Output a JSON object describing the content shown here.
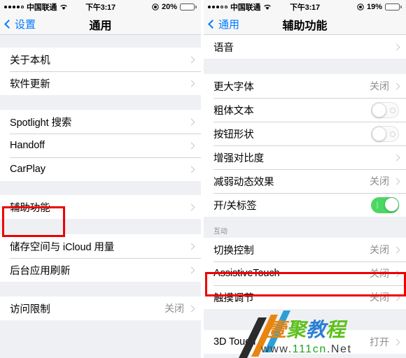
{
  "left_screen": {
    "status_bar": {
      "carrier": "中国联通",
      "signal_dots": 5,
      "signal_filled": 4,
      "wifi_icon": "wifi-icon",
      "time": "下午3:17",
      "lock_icon": "rotation-lock-icon",
      "battery_percent": "20%",
      "battery_level": 20,
      "battery_color": "#f23b30"
    },
    "nav": {
      "back_label": "设置",
      "back_icon": "chevron-left-icon",
      "title": "通用"
    },
    "sections": [
      {
        "header": "",
        "rows": [
          {
            "label": "关于本机",
            "value": "",
            "accessory": "chevron"
          },
          {
            "label": "软件更新",
            "value": "",
            "accessory": "chevron"
          }
        ]
      },
      {
        "header": "",
        "rows": [
          {
            "label": "Spotlight 搜索",
            "value": "",
            "accessory": "chevron"
          },
          {
            "label": "Handoff",
            "value": "",
            "accessory": "chevron"
          },
          {
            "label": "CarPlay",
            "value": "",
            "accessory": "chevron"
          }
        ]
      },
      {
        "header": "",
        "rows": [
          {
            "label": "辅助功能",
            "value": "",
            "accessory": "chevron",
            "highlighted": true
          }
        ]
      },
      {
        "header": "",
        "rows": [
          {
            "label": "储存空间与 iCloud 用量",
            "value": "",
            "accessory": "chevron"
          },
          {
            "label": "后台应用刷新",
            "value": "",
            "accessory": "chevron"
          }
        ]
      },
      {
        "header": "",
        "rows": [
          {
            "label": "访问限制",
            "value": "关闭",
            "accessory": "chevron"
          }
        ]
      }
    ]
  },
  "right_screen": {
    "status_bar": {
      "carrier": "中国联通",
      "signal_dots": 5,
      "signal_filled": 3,
      "wifi_icon": "wifi-icon",
      "time": "下午3:17",
      "lock_icon": "rotation-lock-icon",
      "battery_percent": "19%",
      "battery_level": 19,
      "battery_color": "#f23b30"
    },
    "nav": {
      "back_label": "通用",
      "back_icon": "chevron-left-icon",
      "title": "辅助功能"
    },
    "sections": [
      {
        "header": "",
        "rows": [
          {
            "label": "语音",
            "value": "",
            "accessory": "chevron"
          }
        ]
      },
      {
        "header": "",
        "rows": [
          {
            "label": "更大字体",
            "value": "关闭",
            "accessory": "chevron"
          },
          {
            "label": "粗体文本",
            "value": "",
            "accessory": "switch",
            "switch_on": false
          },
          {
            "label": "按钮形状",
            "value": "",
            "accessory": "switch",
            "switch_on": false
          },
          {
            "label": "增强对比度",
            "value": "",
            "accessory": "chevron"
          },
          {
            "label": "减弱动态效果",
            "value": "关闭",
            "accessory": "chevron"
          },
          {
            "label": "开/关标签",
            "value": "",
            "accessory": "switch",
            "switch_on": true
          }
        ]
      },
      {
        "header": "互动",
        "rows": [
          {
            "label": "切换控制",
            "value": "关闭",
            "accessory": "chevron"
          },
          {
            "label": "AssistiveTouch",
            "value": "关闭",
            "accessory": "chevron",
            "highlighted": true
          },
          {
            "label": "触摸调节",
            "value": "关闭",
            "accessory": "chevron"
          }
        ]
      },
      {
        "header": "",
        "rows": [
          {
            "label": "3D Touch",
            "value": "打开",
            "accessory": "chevron"
          }
        ]
      }
    ]
  },
  "watermark": {
    "chinese": [
      "壹",
      "聚",
      "教",
      "程"
    ],
    "url_parts": [
      "www.",
      "111cn",
      ".Net"
    ],
    "colors": {
      "c1": "#e8850f",
      "c2": "#5cc11a",
      "c3": "#2a7fd4",
      "c4": "#5cc11a"
    }
  },
  "highlight_color": "#ee0000"
}
